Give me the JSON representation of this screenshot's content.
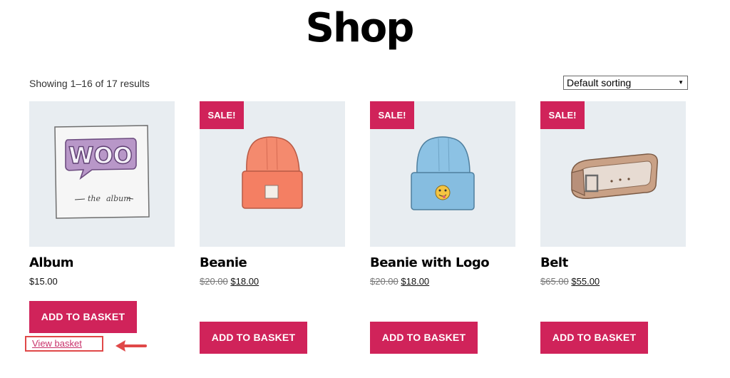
{
  "page": {
    "title": "Shop",
    "result_count": "Showing 1–16 of 17 results",
    "sorting": {
      "selected": "Default sorting"
    }
  },
  "products": [
    {
      "name": "Album",
      "price": "$15.00",
      "sale": false,
      "image": "album-illustration",
      "button": "ADD TO BASKET",
      "view_basket": "View basket"
    },
    {
      "name": "Beanie",
      "old_price": "$20.00",
      "price": "$18.00",
      "sale": true,
      "sale_label": "SALE!",
      "image": "orange-beanie-illustration",
      "button": "ADD TO BASKET"
    },
    {
      "name": "Beanie with Logo",
      "old_price": "$20.00",
      "price": "$18.00",
      "sale": true,
      "sale_label": "SALE!",
      "image": "blue-beanie-logo-illustration",
      "button": "ADD TO BASKET"
    },
    {
      "name": "Belt",
      "old_price": "$65.00",
      "price": "$55.00",
      "sale": true,
      "sale_label": "SALE!",
      "image": "belt-illustration",
      "button": "ADD TO BASKET"
    }
  ],
  "album_art": {
    "logo_text": "WOO",
    "caption_1": "the",
    "caption_2": "album"
  },
  "colors": {
    "accent": "#d0235a",
    "thumb_bg": "#e8edf1",
    "highlight_box": "#e04848",
    "link": "#c8326b"
  }
}
